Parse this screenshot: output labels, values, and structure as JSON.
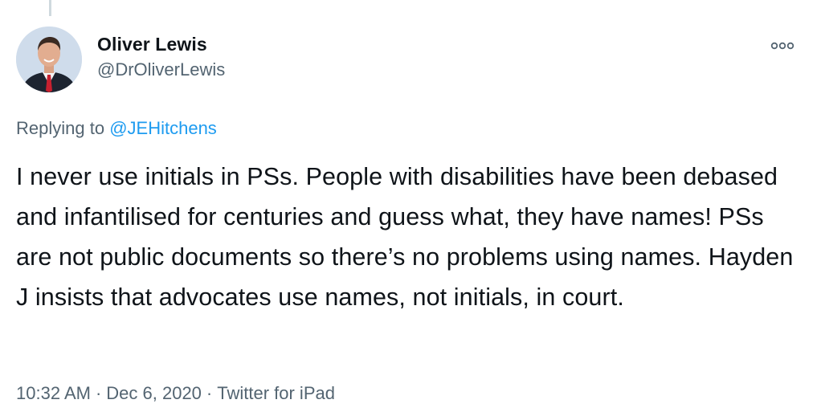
{
  "tweet": {
    "author": {
      "display_name": "Oliver Lewis",
      "handle": "@DrOliverLewis"
    },
    "more_icon": "more-options-icon",
    "replying_prefix": "Replying to",
    "replying_to": "@JEHitchens",
    "text": "I never use initials in PSs. People with disabilities have been debased and infantilised for centuries and guess what, they have names! PSs are not public documents so there’s no problems using names. Hayden J insists that advocates use names, not initials, in court.",
    "time": "10:32 AM",
    "date": "Dec 6, 2020",
    "separator": "·",
    "source": "Twitter for iPad"
  },
  "colors": {
    "primary_text": "#0f1419",
    "secondary_text": "#536471",
    "link": "#1d9bf0",
    "thread_line": "#cfd9de"
  }
}
